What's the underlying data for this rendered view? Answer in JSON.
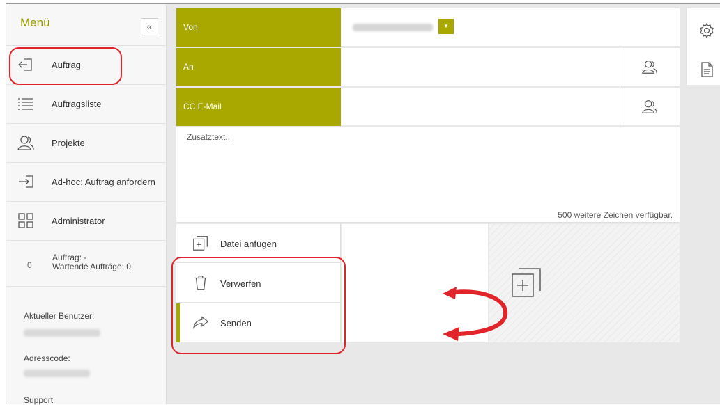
{
  "sidebar": {
    "title": "Menü",
    "collapse_icon": "«",
    "items": [
      {
        "label": "Auftrag",
        "icon": "sign-out-arrow-icon"
      },
      {
        "label": "Auftragsliste",
        "icon": "list-icon"
      },
      {
        "label": "Projekte",
        "icon": "users-icon"
      },
      {
        "label": "Ad-hoc: Auftrag anfordern",
        "icon": "sign-in-arrow-icon"
      },
      {
        "label": "Administrator",
        "icon": "grid-icon"
      }
    ],
    "status": {
      "count": "0",
      "line1": "Auftrag: -",
      "line2": "Wartende Aufträge: 0"
    },
    "current_user_label": "Aktueller Benutzer:",
    "address_code_label": "Adresscode:",
    "support_link": "Support"
  },
  "form": {
    "from_label": "Von",
    "to_label": "An",
    "cc_label": "CC E-Mail",
    "text_placeholder": "Zusatztext..",
    "char_counter": "500 weitere Zeichen verfügbar.",
    "dropdown_icon": "▼"
  },
  "actions": {
    "attach_label": "Datei anfügen",
    "discard_label": "Verwerfen",
    "send_label": "Senden"
  },
  "colors": {
    "accent": "#a8a800",
    "highlight": "#e0242a"
  }
}
